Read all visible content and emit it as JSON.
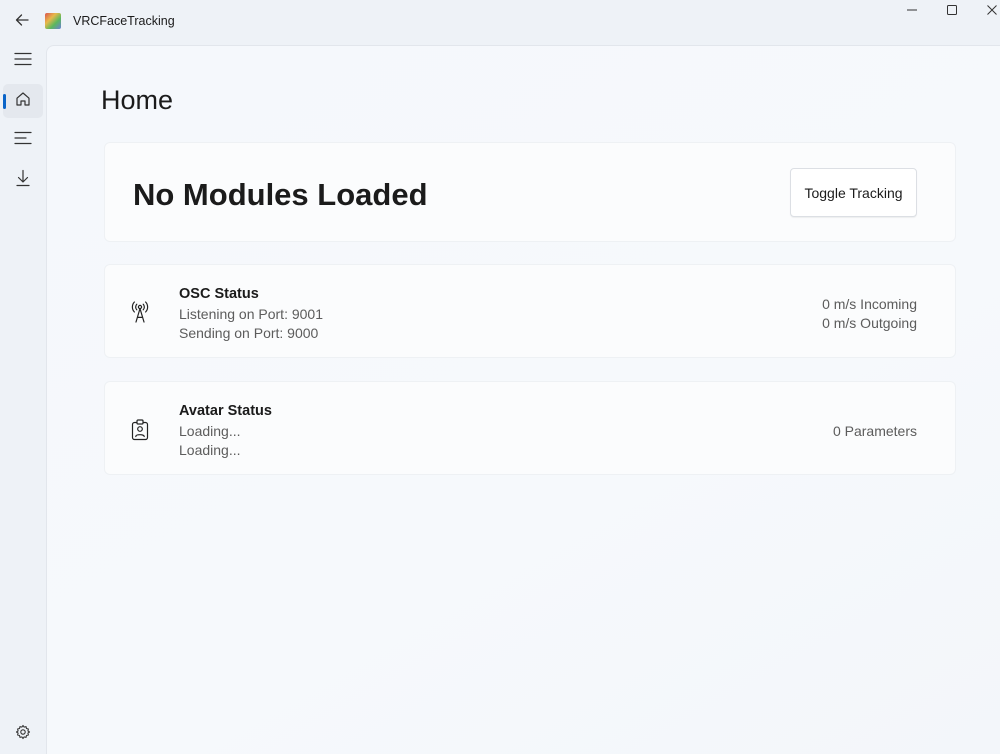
{
  "window": {
    "title": "VRCFaceTracking",
    "icons": {
      "back": "arrow-left-icon",
      "app": "app-logo-icon",
      "minimize": "minimize-icon",
      "maximize": "maximize-icon",
      "close": "close-icon"
    }
  },
  "sidebar": {
    "menu_icon": "hamburger-icon",
    "items": [
      {
        "name": "home",
        "icon": "home-icon",
        "selected": true
      },
      {
        "name": "modules",
        "icon": "list-icon",
        "selected": false
      },
      {
        "name": "downloads",
        "icon": "download-icon",
        "selected": false
      }
    ],
    "settings_icon": "gear-icon",
    "accent": "#0a64c8"
  },
  "main": {
    "title": "Home",
    "modules_card": {
      "heading": "No Modules Loaded",
      "toggle_label": "Toggle Tracking"
    },
    "osc_card": {
      "icon": "antenna-icon",
      "heading": "OSC Status",
      "listening": "Listening on Port: 9001",
      "sending": "Sending on Port: 9000",
      "incoming": "0 m/s Incoming",
      "outgoing": "0 m/s Outgoing"
    },
    "avatar_card": {
      "icon": "id-badge-icon",
      "heading": "Avatar Status",
      "line1": "Loading...",
      "line2": "Loading...",
      "parameters": "0 Parameters"
    }
  }
}
